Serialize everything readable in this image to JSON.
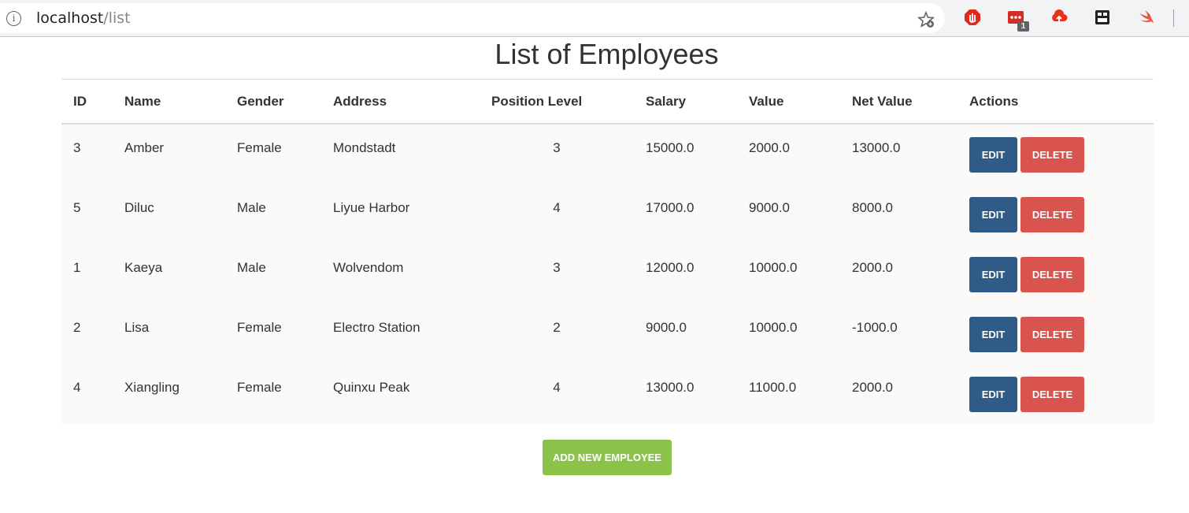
{
  "browser": {
    "url_host": "localhost",
    "url_path": "/list",
    "extension_badge": "1",
    "colors": {
      "toolbar_bg": "#f1f3f4"
    }
  },
  "page": {
    "title": "List of Employees",
    "headers": {
      "id": "ID",
      "name": "Name",
      "gender": "Gender",
      "address": "Address",
      "position_level": "Position Level",
      "salary": "Salary",
      "value": "Value",
      "net_value": "Net Value",
      "actions": "Actions"
    },
    "rows": [
      {
        "id": "3",
        "name": "Amber",
        "gender": "Female",
        "address": "Mondstadt",
        "position_level": "3",
        "salary": "15000.0",
        "value": "2000.0",
        "net_value": "13000.0"
      },
      {
        "id": "5",
        "name": "Diluc",
        "gender": "Male",
        "address": "Liyue Harbor",
        "position_level": "4",
        "salary": "17000.0",
        "value": "9000.0",
        "net_value": "8000.0"
      },
      {
        "id": "1",
        "name": "Kaeya",
        "gender": "Male",
        "address": "Wolvendom",
        "position_level": "3",
        "salary": "12000.0",
        "value": "10000.0",
        "net_value": "2000.0"
      },
      {
        "id": "2",
        "name": "Lisa",
        "gender": "Female",
        "address": "Electro Station",
        "position_level": "2",
        "salary": "9000.0",
        "value": "10000.0",
        "net_value": "-1000.0"
      },
      {
        "id": "4",
        "name": "Xiangling",
        "gender": "Female",
        "address": "Quinxu Peak",
        "position_level": "4",
        "salary": "13000.0",
        "value": "11000.0",
        "net_value": "2000.0"
      }
    ],
    "edit_label": "EDIT",
    "delete_label": "DELETE",
    "add_label": "ADD NEW EMPLOYEE",
    "colors": {
      "edit": "#2f5b88",
      "delete": "#d9534f",
      "add": "#8bc34a"
    }
  }
}
